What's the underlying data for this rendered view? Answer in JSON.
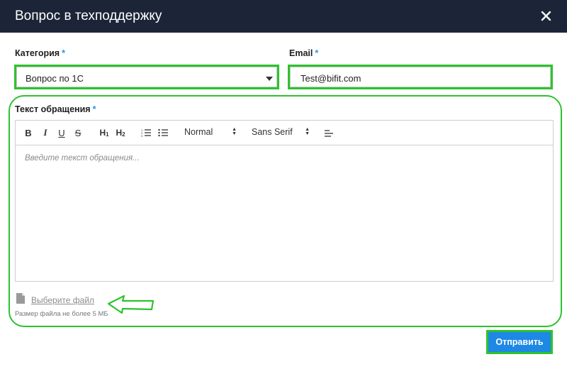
{
  "dialog": {
    "title": "Вопрос в техподдержку"
  },
  "form": {
    "category": {
      "label": "Категория",
      "required_mark": "*",
      "selected": "Вопрос по 1С"
    },
    "email": {
      "label": "Email",
      "required_mark": "*",
      "value": "Test@bifit.com"
    },
    "message": {
      "label": "Текст обращения",
      "required_mark": "*",
      "placeholder": "Введите текст обращения..."
    },
    "toolbar": {
      "bold": "B",
      "italic": "I",
      "underline": "U",
      "strike": "S",
      "h1": "H",
      "h1_sub": "1",
      "h2": "H",
      "h2_sub": "2",
      "size_select": "Normal",
      "font_select": "Sans Serif"
    },
    "attachment": {
      "link_text": "Выберите файл",
      "hint": "Размер файла не более 5 МБ"
    },
    "submit_label": "Отправить"
  },
  "colors": {
    "header_bg": "#1c2538",
    "highlight": "#2ec22e",
    "accent": "#1e88e5",
    "required": "#2d95e6"
  }
}
